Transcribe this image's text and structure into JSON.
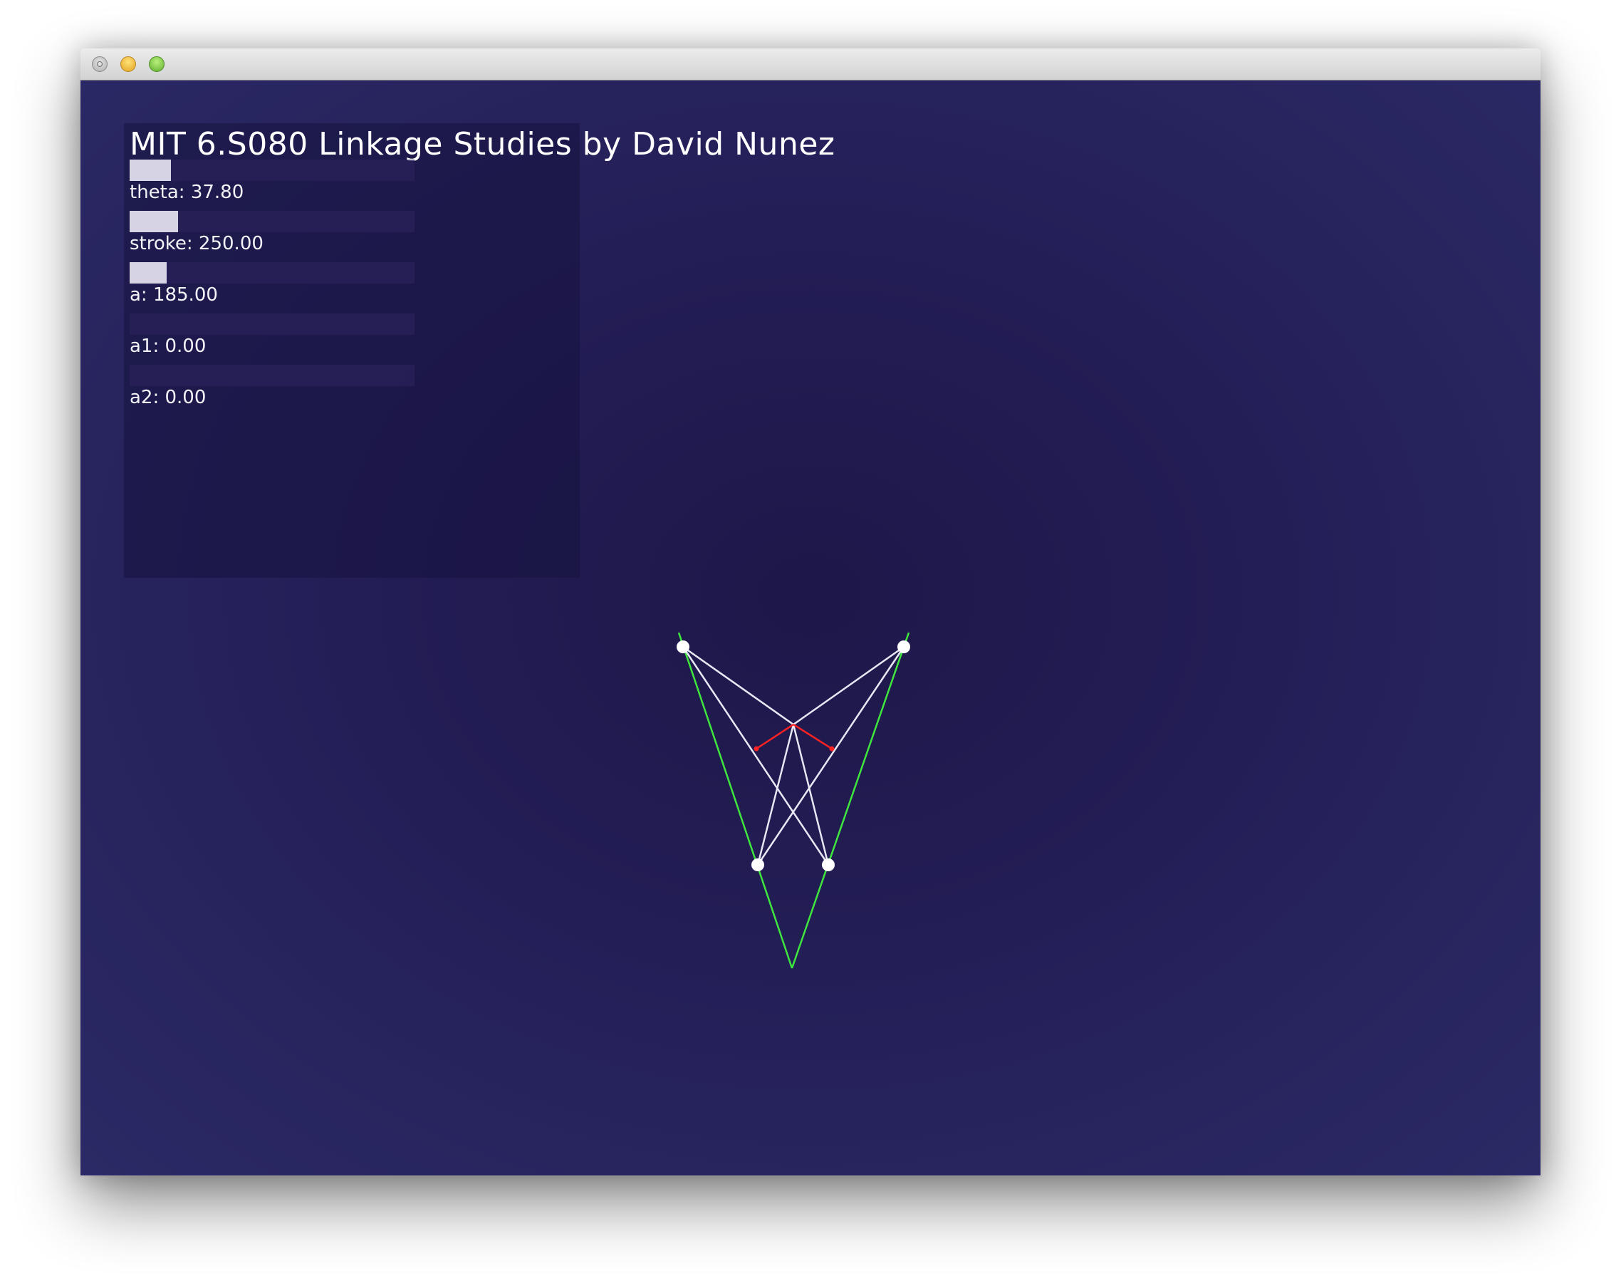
{
  "window": {
    "buttons": [
      "close",
      "minimize",
      "zoom"
    ]
  },
  "app": {
    "title": "MIT 6.S080 Linkage Studies by David Nunez"
  },
  "controls": [
    {
      "name": "theta",
      "label": "theta:",
      "value": "37.80",
      "level": 0.145
    },
    {
      "name": "stroke",
      "label": "stroke:",
      "value": "250.00",
      "level": 0.17
    },
    {
      "name": "a",
      "label": "a:",
      "value": "185.00",
      "level": 0.13
    },
    {
      "name": "a1",
      "label": "a1:",
      "value": "0.00",
      "level": 0
    },
    {
      "name": "a2",
      "label": "a2:",
      "value": "0.00",
      "level": 0
    }
  ],
  "colors": {
    "background": "#231d55",
    "links_white": "#e8e8f4",
    "links_green": "#3ee63e",
    "links_red": "#ff2222",
    "slider_fill": "#d6d4e4"
  }
}
